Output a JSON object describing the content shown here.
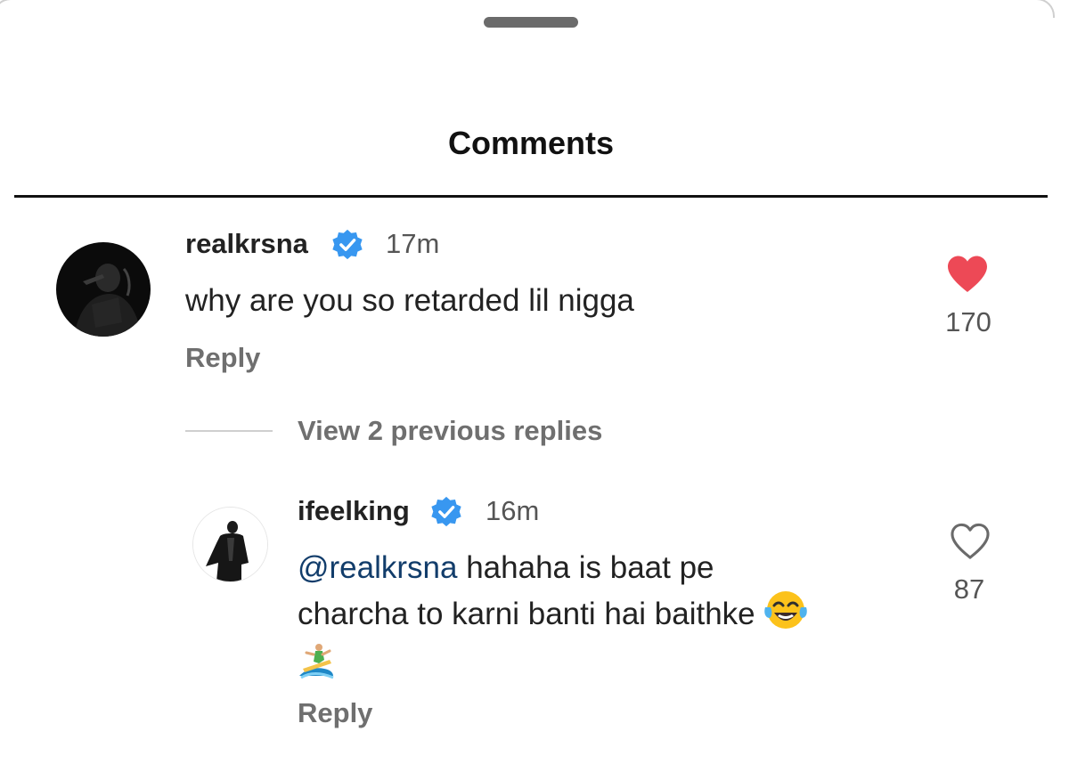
{
  "sheet": {
    "title": "Comments"
  },
  "comments": [
    {
      "username": "realkrsna",
      "verified": true,
      "time": "17m",
      "text": "why are you so retarded lil nigga",
      "reply_label": "Reply",
      "likes": "170",
      "liked": true
    }
  ],
  "view_replies_label": "View 2 previous replies",
  "replies": [
    {
      "username": "ifeelking",
      "verified": true,
      "time": "16m",
      "mention": "@realkrsna",
      "text_line1": " hahaha is baat pe",
      "text_line2": "charcha to karni banti hai baithke",
      "emoji_1": "face-with-tears-of-joy",
      "emoji_2": "person-surfing",
      "reply_label": "Reply",
      "likes": "87",
      "liked": false
    }
  ],
  "colors": {
    "verified_blue": "#3897f0",
    "like_red": "#ed4956",
    "mention": "#123d6b"
  }
}
